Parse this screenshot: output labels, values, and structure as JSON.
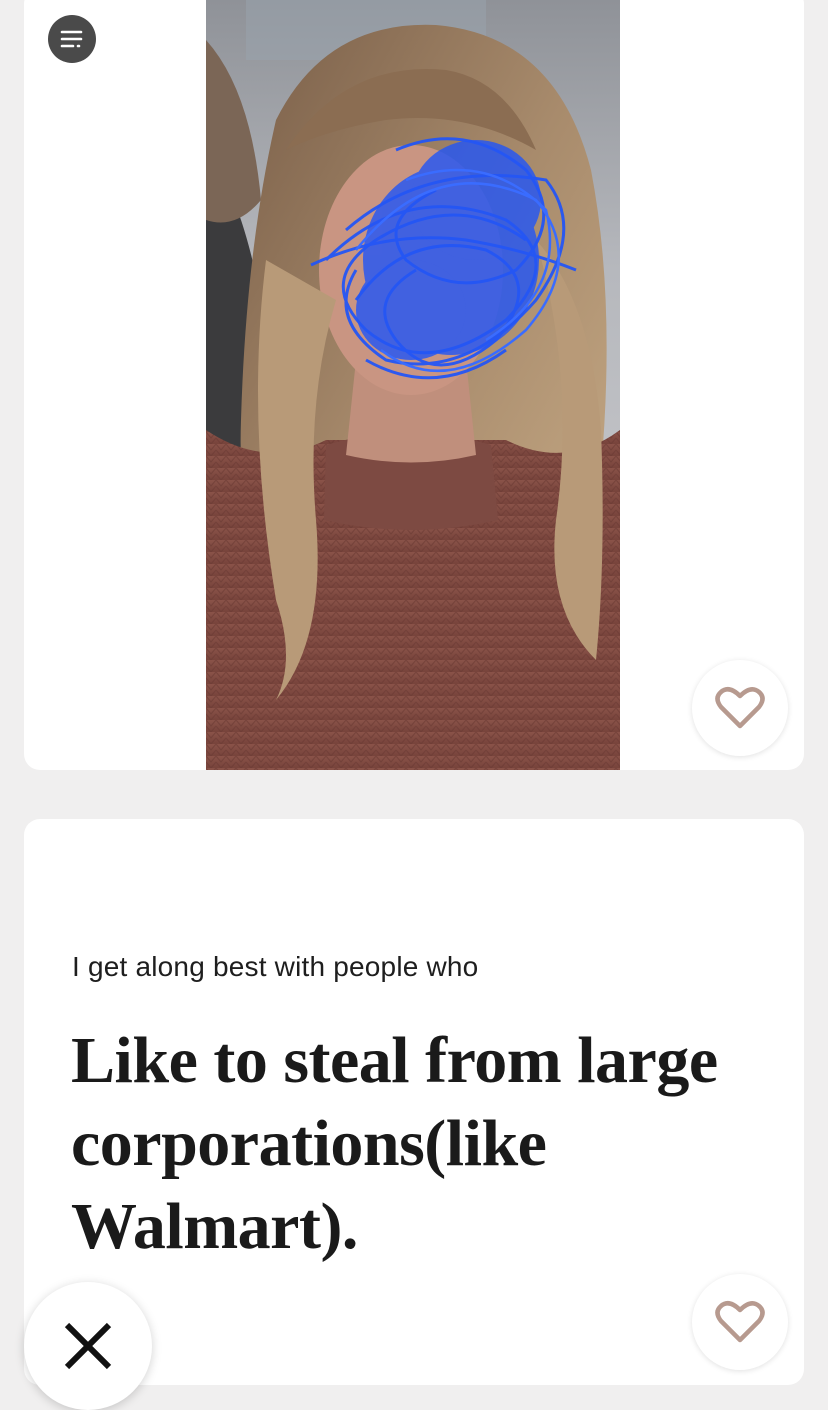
{
  "profile": {
    "photo": {
      "alt": "",
      "face_obscured": true
    },
    "prompt": {
      "label": "I get along best with people who",
      "answer": "Like to steal from large corporations(like Walmart)."
    }
  },
  "icons": {
    "menu": "filter-lines-icon",
    "like": "heart-outline-icon",
    "skip": "x-close-icon"
  },
  "colors": {
    "background": "#f0efef",
    "card": "#ffffff",
    "heart_stroke": "#b79a8f",
    "menu_button": "#4a4a4a",
    "text": "#1a1a1a",
    "scribble": "#2456f5"
  }
}
